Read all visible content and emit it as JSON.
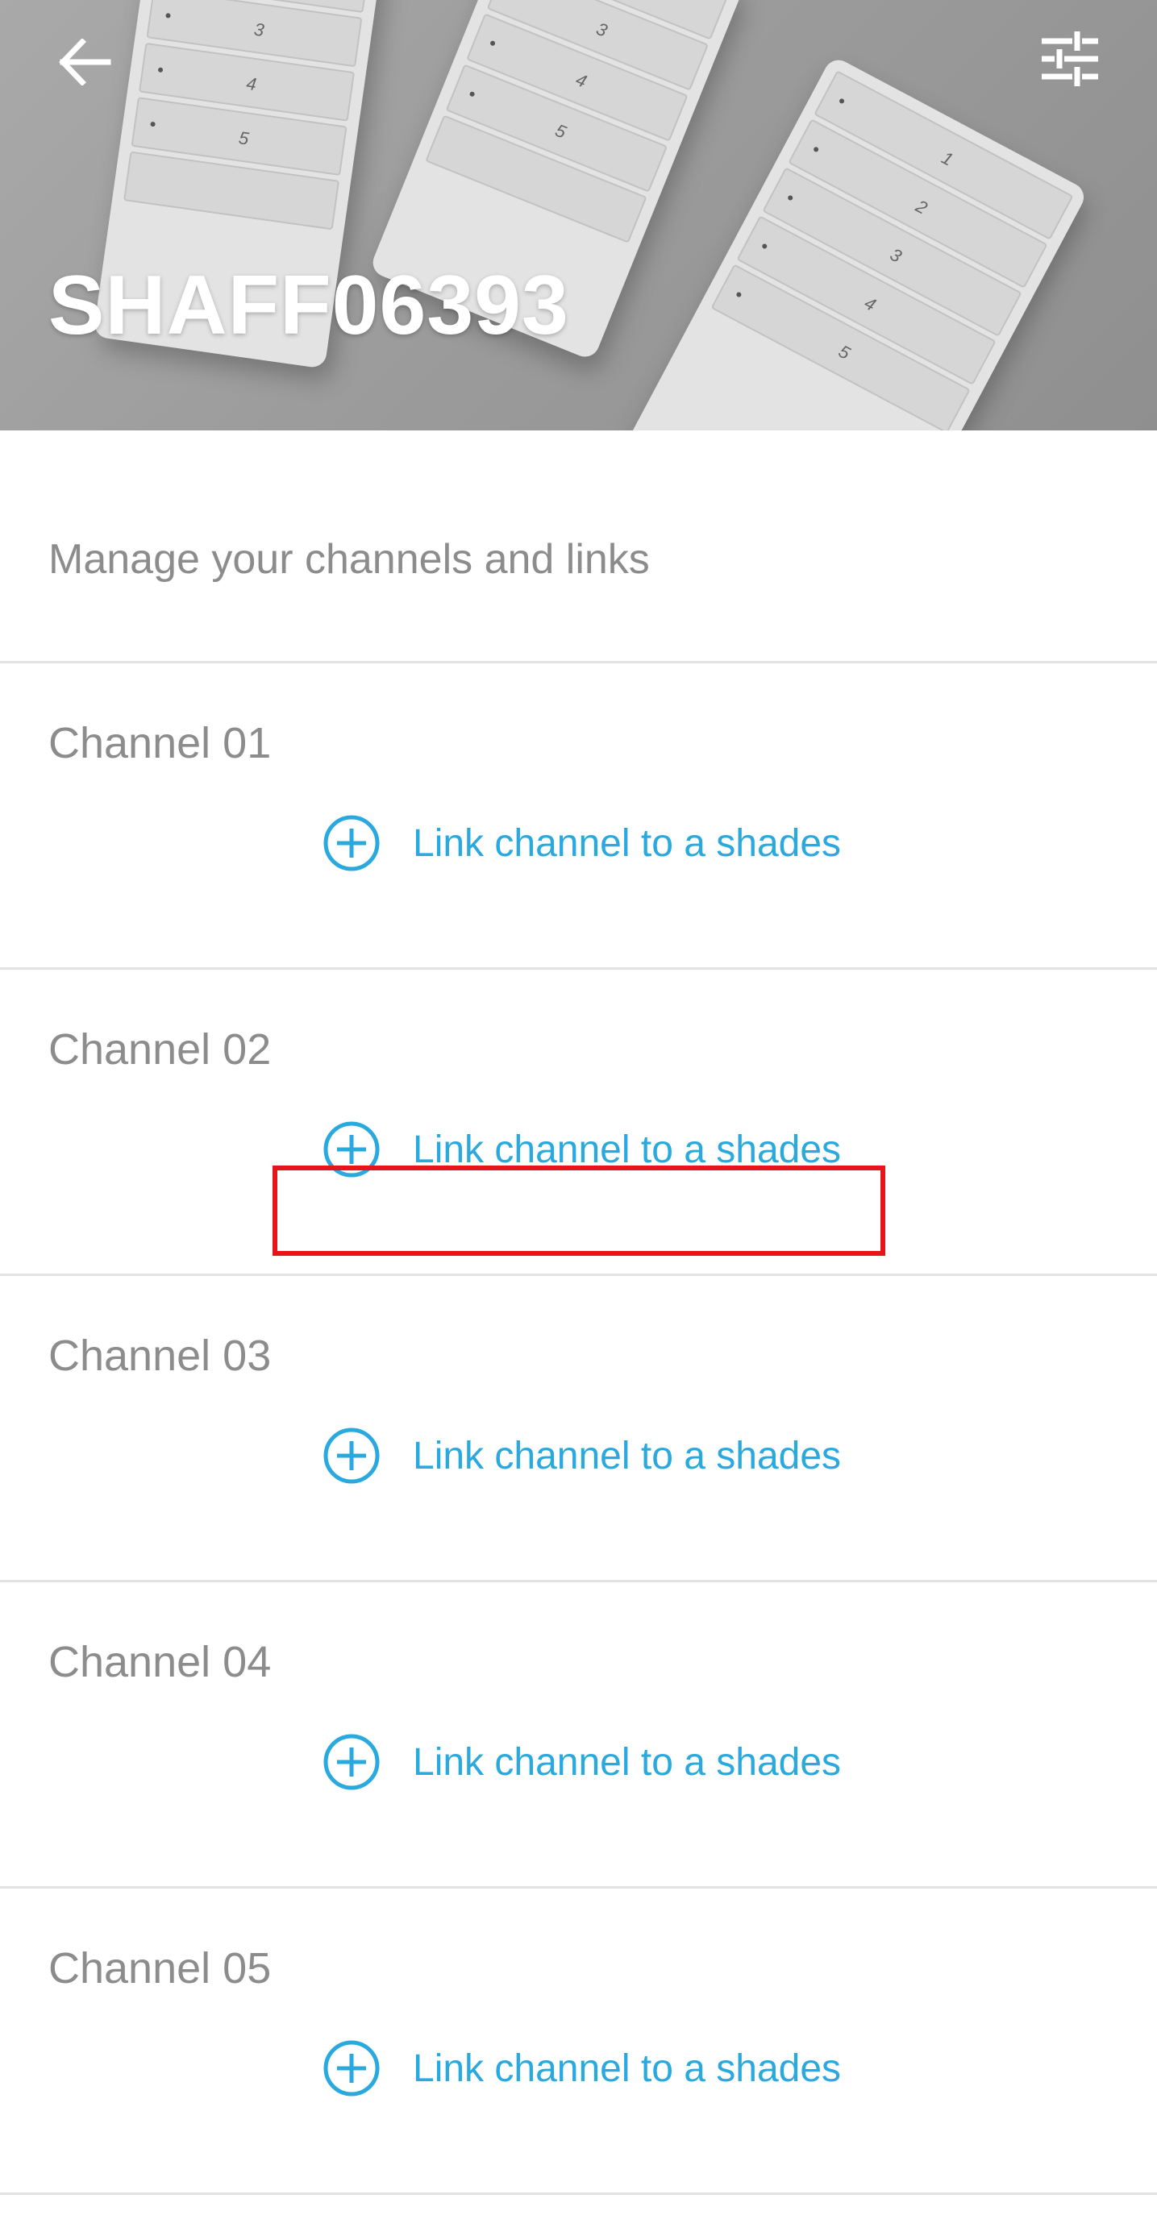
{
  "header": {
    "device_name": "SHAFF06393",
    "back_icon": "arrow-left-icon",
    "settings_icon": "sliders-icon",
    "background": "remote-controls-photo",
    "remote_buttons": [
      "1",
      "2",
      "3",
      "4",
      "5"
    ]
  },
  "subtitle": "Manage your channels and links",
  "channels": [
    {
      "name": "Channel 01",
      "link_label": "Link channel to a shades"
    },
    {
      "name": "Channel 02",
      "link_label": "Link channel to a shades"
    },
    {
      "name": "Channel 03",
      "link_label": "Link channel to a shades"
    },
    {
      "name": "Channel 04",
      "link_label": "Link channel to a shades"
    },
    {
      "name": "Channel 05",
      "link_label": "Link channel to a shades"
    }
  ],
  "colors": {
    "accent": "#2aa9df",
    "text_secondary": "#8c8c8c",
    "divider": "#e3e3e3",
    "highlight": "#e8141b"
  },
  "highlighted_channel_index": 1
}
